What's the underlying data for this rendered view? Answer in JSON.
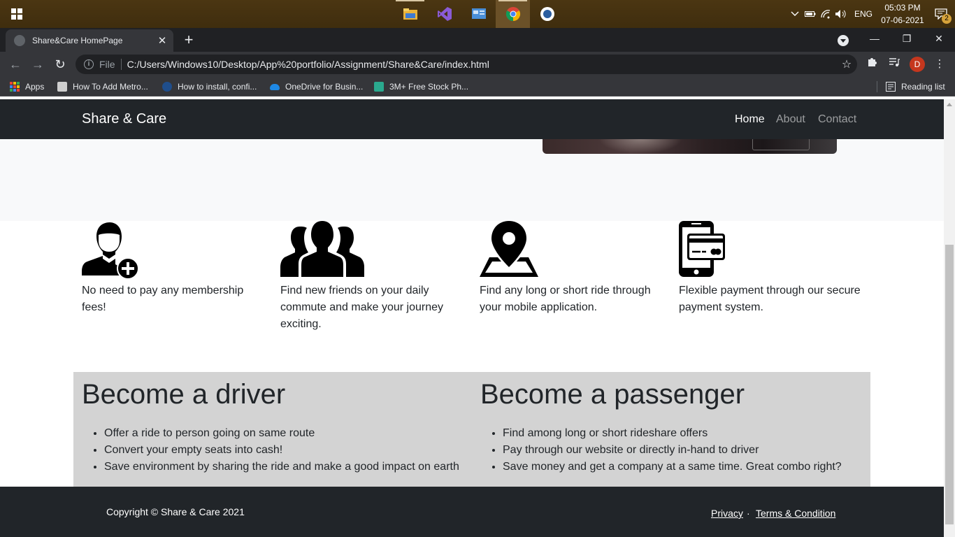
{
  "taskbar": {
    "apps": [
      "file-explorer",
      "visual-studio",
      "control-panel",
      "chrome",
      "app"
    ],
    "language": "ENG",
    "time": "05:03 PM",
    "date": "07-06-2021",
    "notification_count": "2"
  },
  "browser": {
    "tab_title": "Share&Care HomePage",
    "new_tab": "+",
    "url_scheme": "File",
    "url": "C:/Users/Windows10/Desktop/App%20portfolio/Assignment/Share&Care/index.html",
    "profile_initial": "D",
    "bookmarks": [
      {
        "label": "Apps"
      },
      {
        "label": "How To Add Metro..."
      },
      {
        "label": "How to install, confi..."
      },
      {
        "label": "OneDrive for Busin..."
      },
      {
        "label": "3M+ Free Stock Ph..."
      }
    ],
    "reading_list": "Reading list"
  },
  "page": {
    "brand": "Share & Care",
    "nav": [
      {
        "label": "Home",
        "active": true
      },
      {
        "label": "About",
        "active": false
      },
      {
        "label": "Contact",
        "active": false
      }
    ],
    "features": [
      {
        "icon": "user-add-icon",
        "text": "No need to pay any membership fees!"
      },
      {
        "icon": "group-icon",
        "text": "Find new friends on your daily commute and make your journey exciting."
      },
      {
        "icon": "map-pin-icon",
        "text": "Find any long or short ride through your mobile application."
      },
      {
        "icon": "mobile-payment-icon",
        "text": "Flexible payment through our secure payment system."
      }
    ],
    "driver": {
      "title": "Become a driver",
      "items": [
        "Offer a ride to person going on same route",
        "Convert your empty seats into cash!",
        "Save environment by sharing the ride and make a good impact on earth"
      ]
    },
    "passenger": {
      "title": "Become a passenger",
      "items": [
        "Find among long or short rideshare offers",
        "Pay through our website or directly in-hand to driver",
        "Save money and get a company at a same time. Great combo right?"
      ]
    },
    "footer": {
      "copyright": "Copyright © Share & Care 2021",
      "privacy": "Privacy",
      "separator": "·",
      "terms": "Terms & Condition"
    }
  },
  "colors": {
    "navbar_bg": "#212529",
    "hero_bg": "#f8f9fa",
    "section_bg": "#d3d3d3",
    "taskbar_bg": "#4a3510"
  }
}
